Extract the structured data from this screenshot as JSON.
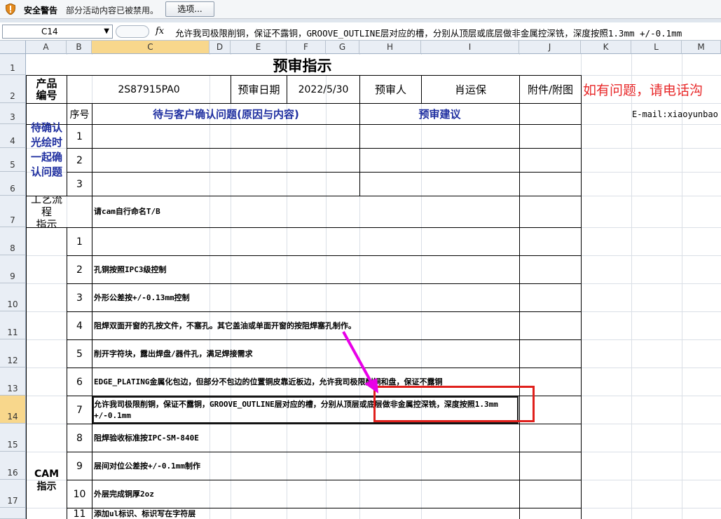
{
  "security_bar": {
    "warning_label": "安全警告",
    "message": "部分活动内容已被禁用。",
    "options_button": "选项..."
  },
  "formula_bar": {
    "name_box": "C14",
    "fx_label": "fx",
    "content": "允许我司极限削铜，保证不露铜，GROOVE_OUTLINE层对应的槽，分别从顶层或底层做非金属控深铣，深度按照1.3mm +/-0.1mm"
  },
  "columns": [
    "A",
    "B",
    "C",
    "D",
    "E",
    "F",
    "G",
    "H",
    "I",
    "J",
    "K",
    "L",
    "M"
  ],
  "rows": [
    "1",
    "2",
    "3",
    "4",
    "5",
    "6",
    "7",
    "8",
    "9",
    "10",
    "11",
    "12",
    "13",
    "14",
    "15",
    "16",
    "17"
  ],
  "selected": {
    "column": "C",
    "row": "14"
  },
  "sheet": {
    "title": "预审指示",
    "product_no_label": "产品\n编号",
    "product_no": "2S87915PA0",
    "review_date_label": "预审日期",
    "review_date": "2022/5/30",
    "reviewer_label": "预审人",
    "reviewer": "肖运保",
    "attachment_label": "附件/附图",
    "contact_note": "如有问题，请电话沟",
    "email": "E-mail:xiaoyunbao",
    "seq_label": "序号",
    "question_header": "待与客户确认问题(原因与内容)",
    "suggest_header": "预审建议",
    "confirm_label": "待确认\n光绘时\n一起确\n认问题",
    "confirm_nums": [
      "1",
      "2",
      "3"
    ],
    "process_label": "工艺流程\n指示",
    "process_text": "请cam自行命名T/B",
    "cam_label": "CAM\n指示",
    "cam_items": [
      {
        "num": "1",
        "text": ""
      },
      {
        "num": "2",
        "text": "孔铜按照IPC3级控制"
      },
      {
        "num": "3",
        "text": "外形公差按+/-0.13mm控制"
      },
      {
        "num": "4",
        "text": "阻焊双面开窗的孔按文件，不塞孔。其它盖油或单面开窗的按阻焊塞孔制作。"
      },
      {
        "num": "5",
        "text": "削开字符块，露出焊盘/器件孔，满足焊接需求"
      },
      {
        "num": "6",
        "text": "EDGE_PLATING金属化包边，但部分不包边的位置铜皮靠近板边，允许我司极限削铜和盘，保证不露铜"
      },
      {
        "num": "7",
        "text": "允许我司极限削铜，保证不露铜，GROOVE_OUTLINE层对应的槽，分别从顶层或底层做非金属控深铣，深度按照1.3mm +/-0.1mm"
      },
      {
        "num": "8",
        "text": "阻焊验收标准按IPC-SM-840E"
      },
      {
        "num": "9",
        "text": "层间对位公差按+/-0.1mm制作"
      },
      {
        "num": "10",
        "text": "外层完成铜厚2oz"
      },
      {
        "num": "11",
        "text": "添加ul标识、标识写在字符层"
      }
    ]
  },
  "colors": {
    "highlight_box": "#e0201c",
    "arrow": "#e800e8",
    "header_blue": "#1f2fa0",
    "contact_red": "#e8292a",
    "selected_header": "#f8d78c"
  }
}
